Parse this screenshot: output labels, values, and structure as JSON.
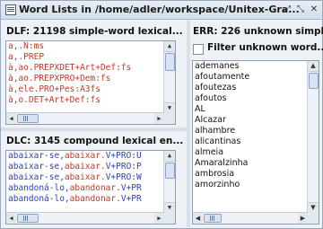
{
  "window": {
    "title": "Word Lists in /home/adler/workspace/Unitex-Gra...",
    "btn_restore": "⤢",
    "btn_maximize": "⤡",
    "btn_close": "✕"
  },
  "dlf": {
    "title": "DLF: 21198 simple-word lexical...",
    "rows": [
      {
        "a": "a,.N:ms",
        "b": "",
        "c": ""
      },
      {
        "a": "a,.PREP",
        "b": "",
        "c": ""
      },
      {
        "a": "à,ao.PREPXDET+Art+Def:fs",
        "b": "",
        "c": ""
      },
      {
        "a": "à,ao.PREPXPRO+Dem:fs",
        "b": "",
        "c": ""
      },
      {
        "a": "à,ele.PRO+Pes:A3fs",
        "b": "",
        "c": ""
      },
      {
        "a": "à,o.DET+Art+Def:fs",
        "b": "",
        "c": ""
      }
    ]
  },
  "dlc": {
    "title": "DLC: 3145 compound lexical en...",
    "rows": [
      {
        "a": "abaixar-se,",
        "b": "abaixar.",
        "c": "V+PRO:U"
      },
      {
        "a": "abaixar-se,",
        "b": "abaixar.",
        "c": "V+PRO:P"
      },
      {
        "a": "abaixar-se,",
        "b": "abaixar.",
        "c": "V+PRO:W"
      },
      {
        "a": "abandoná-lo,",
        "b": "abandonar.",
        "c": "V+PR"
      },
      {
        "a": "abandoná-lo,",
        "b": "abandonar.",
        "c": "V+PR"
      }
    ]
  },
  "err": {
    "title": "ERR: 226 unknown simpl...",
    "filter_label": "Filter unknown word...",
    "filter_checked": false,
    "rows": [
      "ademanes",
      "afoutamente",
      "afoutezas",
      "afoutos",
      "AL",
      "Alcazar",
      "alhambre",
      "alicantinas",
      "almeia",
      "Amaralzinha",
      "ambrosia",
      "amorzinho"
    ]
  }
}
